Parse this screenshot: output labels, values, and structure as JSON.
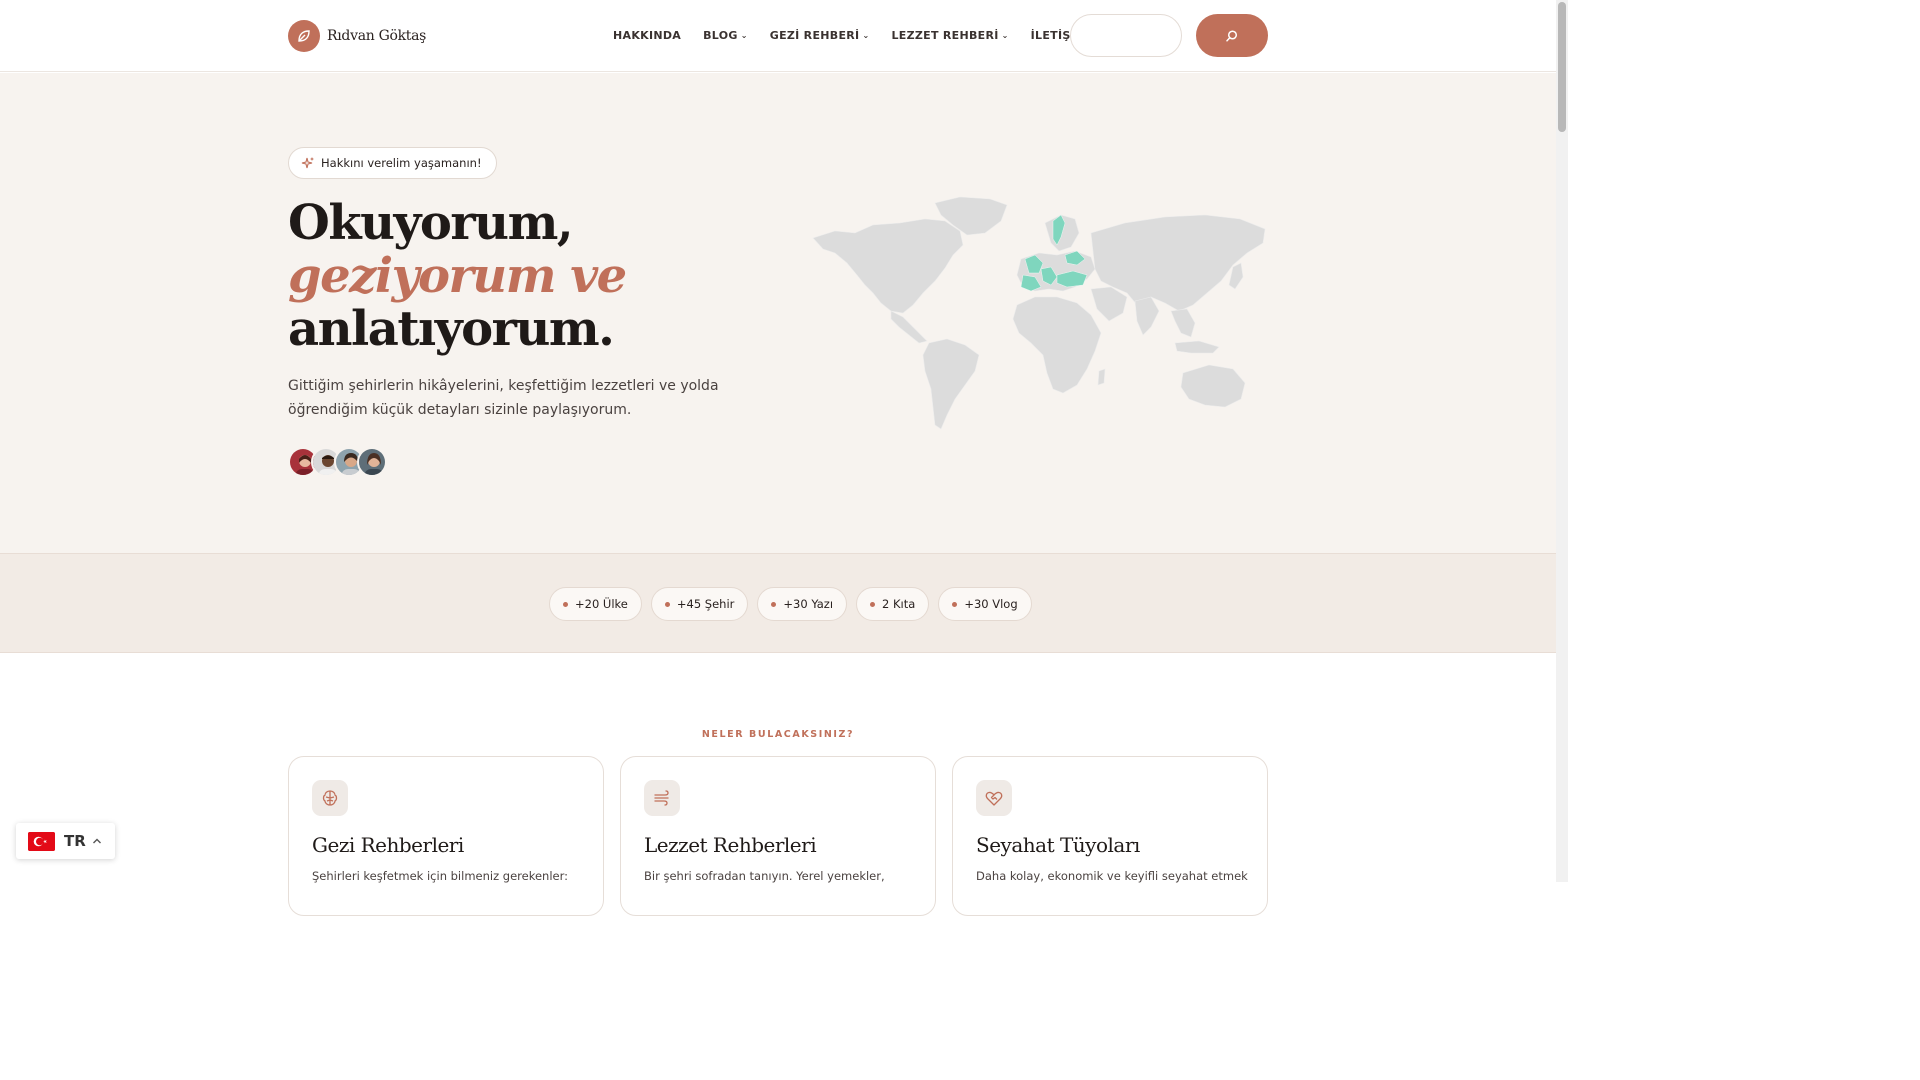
{
  "header": {
    "logo_text": "Rıdvan Göktaş",
    "nav": [
      {
        "label": "HAKKINDA",
        "dropdown": false
      },
      {
        "label": "BLOG",
        "dropdown": true
      },
      {
        "label": "GEZİ REHBERİ",
        "dropdown": true
      },
      {
        "label": "LEZZET REHBERİ",
        "dropdown": true
      },
      {
        "label": "İLETİŞİM",
        "dropdown": false
      }
    ],
    "search_placeholder": "",
    "search_icon": "search-icon"
  },
  "hero": {
    "pill": "Hakkını verelim yaşamanın!",
    "pill_icon": "sparkles-icon",
    "headline_line1": "Okuyorum,",
    "headline_line2": "geziyorum ve",
    "headline_line3": "anlatıyorum.",
    "lead": "Gittiğim şehirlerin hikâyelerini, keşfettiğim lezzetleri ve yolda öğrendiğim küçük detayları sizinle paylaşıyorum.",
    "avatar_count": 4
  },
  "stats": [
    {
      "label": "+20 Ülke"
    },
    {
      "label": "+45 Şehir"
    },
    {
      "label": "+30 Yazı"
    },
    {
      "label": "2 Kıta"
    },
    {
      "label": "+30 Vlog"
    }
  ],
  "features": {
    "kicker": "NELER BULACAKSINIZ?",
    "cards": [
      {
        "title": "Gezi Rehberleri",
        "desc": "Şehirleri keşfetmek için bilmeniz gerekenler:",
        "icon": "brain-icon"
      },
      {
        "title": "Lezzet Rehberleri",
        "desc": "Bir şehri sofradan tanıyın. Yerel yemekler,",
        "icon": "wind-icon"
      },
      {
        "title": "Seyahat Tüyoları",
        "desc": "Daha kolay, ekonomik ve keyifli seyahat etmek",
        "icon": "heart-handshake-icon"
      }
    ]
  },
  "language": {
    "code": "TR",
    "flag": "turkey-flag-icon"
  },
  "colors": {
    "accent": "#c0705a",
    "hero_bg": "#f7f3ef",
    "stats_bg": "#f2ebe5",
    "map_land": "#dcdcdc",
    "map_visited": "#7fd6be"
  }
}
